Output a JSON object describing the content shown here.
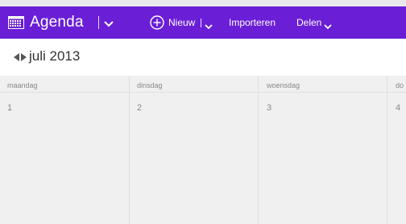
{
  "colors": {
    "accent": "#6a1ed6"
  },
  "app": {
    "title": "Agenda",
    "icon": "calendar-grid-icon"
  },
  "toolbar": {
    "new_label": "Nieuw",
    "import_label": "Importeren",
    "share_label": "Delen"
  },
  "month": {
    "label": "juli 2013"
  },
  "week": {
    "days": [
      {
        "name": "maandag",
        "number": "1"
      },
      {
        "name": "dinsdag",
        "number": "2"
      },
      {
        "name": "woensdag",
        "number": "3"
      },
      {
        "name": "do",
        "number": "4"
      }
    ]
  }
}
